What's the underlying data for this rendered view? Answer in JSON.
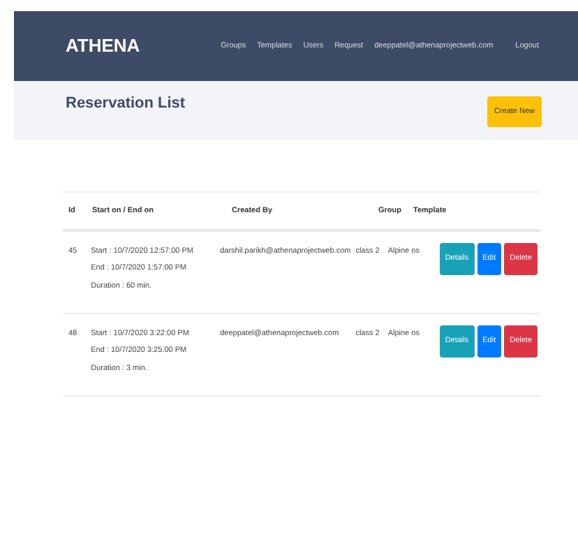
{
  "navbar": {
    "brand": "ATHENA",
    "links": [
      "Groups",
      "Templates",
      "Users",
      "Request",
      "deeppatel@athenaprojectweb.com",
      "Logout"
    ]
  },
  "header": {
    "title": "Reservation List",
    "button": "Create New"
  },
  "table": {
    "columns": [
      "Id",
      "Start on / End on",
      "Created By",
      "Group",
      "Template"
    ],
    "rows": [
      {
        "id": "45",
        "start": "Start : 10/7/2020 12:57:00 PM",
        "end": "End : 10/7/2020 1:57:00 PM",
        "duration": "Duration : 60 min.",
        "created_by": "darshil.parikh@athenaprojectweb.com",
        "group": "class 2",
        "template": "Alpine os",
        "actions": [
          "Details",
          "Edit",
          "Delete"
        ]
      },
      {
        "id": "48",
        "start": "Start : 10/7/2020 3:22:00 PM",
        "end": "End : 10/7/2020 3:25:00 PM",
        "duration": "Duration : 3 min.",
        "created_by": "deeppatel@athenaprojectweb.com",
        "group": "class 2",
        "template": "Alpine os",
        "actions": [
          "Details",
          "Edit",
          "Delete"
        ]
      }
    ]
  }
}
